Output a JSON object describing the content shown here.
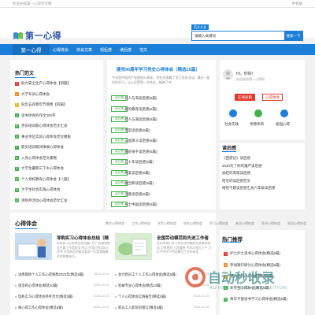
{
  "topbar": {
    "welcome": "欢迎光临第一心得范文网",
    "mobile": "手机版"
  },
  "logo": {
    "text": "第一心得"
  },
  "search": {
    "tag": "范文大全",
    "value": "请输入关键词",
    "button": "搜索一下"
  },
  "nav": {
    "brand": "第一心得",
    "items": [
      "心得体会",
      "体会文章",
      "观后感",
      "读后感",
      "范文"
    ]
  },
  "hot": {
    "title": "热门范文",
    "items": [
      {
        "num": "1",
        "text": "助力安全生产心得体会【四篇】",
        "color": "#e23a2e"
      },
      {
        "num": "2",
        "text": "大学军训心得体会",
        "color": "#f08c2e"
      },
      {
        "num": "3",
        "text": "纪念五四青年节感想【四篇】",
        "color": "#f0b52e"
      },
      {
        "num": "4",
        "text": "读书体会的作文300字",
        "color": "#42b14b"
      },
      {
        "num": "5",
        "text": "党员培训期心得体会范文汇总",
        "color": "#42b14b"
      },
      {
        "num": "6",
        "text": "事业单位实验心得体会范文模板",
        "color": "#42b14b"
      },
      {
        "num": "7",
        "text": "职员培训期间填收心得体会",
        "color": "#42b14b"
      },
      {
        "num": "8",
        "text": "入党心得体会范文集锦",
        "color": "#42b14b"
      },
      {
        "num": "9",
        "text": "大学生暑期三下乡心得体会",
        "color": "#42b14b"
      },
      {
        "num": "10",
        "text": "个人党校教育心得体会【八篇】",
        "color": "#42b14b"
      },
      {
        "num": "11",
        "text": "大学生社会实践心得体会",
        "color": "#42b14b"
      },
      {
        "num": "12",
        "text": "消防月活动心得体会范文汇总",
        "color": "#42b14b"
      }
    ]
  },
  "feature": {
    "title": "建党90周年学习党史心得体会（精选15篇）",
    "summary": "今年是中国共产党建党90周年。党在光荣履了学习党史活动。通过一段时间学习，让心灵受到一次洗礼，精神了许",
    "rows": [
      {
        "tag": "读后感",
        "title": "老人与海读后感(5篇)"
      },
      {
        "tag": "读后感",
        "title": "爱的教育读后感(5篇)"
      },
      {
        "tag": "读后感",
        "title": "老人与海读后感(5篇)"
      },
      {
        "tag": "读后感",
        "title": "无常读后感(5篇)"
      },
      {
        "tag": "读后感",
        "title": "三国演义读后感(5篇)"
      },
      {
        "tag": "读后感",
        "title": "骆驼祥子读后感(5篇)"
      },
      {
        "tag": "读后感",
        "title": "五十年读后感(5篇)"
      },
      {
        "tag": "读后感",
        "title": "简爱读后感(5篇)"
      },
      {
        "tag": "读后感",
        "title": "雅当和读后感(5篇)"
      },
      {
        "tag": "读后感",
        "title": "活着读后感(5篇)"
      },
      {
        "tag": "读后感",
        "title": "乡土中国读后感(5篇)"
      }
    ]
  },
  "user": {
    "greeting": "Hi，你好!",
    "sub": "欢迎来到第一心得网",
    "contribute": "在线投稿",
    "register": "心得体会",
    "icons": [
      {
        "label": "社会实践",
        "name": "briefcase-icon",
        "color": "#1c80d8"
      },
      {
        "label": "师德师风",
        "name": "book-icon",
        "color": "#42b14b"
      },
      {
        "label": "爱国心得",
        "name": "heart-icon",
        "color": "#1c80d8"
      }
    ]
  },
  "readafter": {
    "title": "读后感",
    "items": [
      "《西游记》读后感",
      "2020为了你的遵严读后感",
      "加娃的黑暗读后感",
      "哈尼的读后感范文",
      "哈哈千题读后感汇总六年级读后感"
    ]
  },
  "experience": {
    "title": "心得体会",
    "cats": [
      "教学心得体会",
      "工作心得体会",
      "学生心得体会",
      "综合心得体会",
      "学习心得体会",
      "安全心得体会",
      "军训心得体会",
      "党员心得体会"
    ],
    "articles": [
      {
        "title": "导购实习心得体会总结（精",
        "summary": "导购实习心得体会总结篇1 在广店最销售这主要工作是职务 所以 在我们的实际工作中 对导购员的基本要求一定要掌握基本的销售技巧…"
      },
      {
        "title": "全国劳动模范和先进工作者",
        "summary": "是如果我们学习的先进劳模的先进事迹材料 记得提到 工匠精神 今年20多位上午 习近平的关于劳动模范工作的讲话…"
      }
    ],
    "list": [
      {
        "text": "试用期转个人工作心得感想2023年(精选5篇)",
        "date": "2024-10-15"
      },
      {
        "text": "会计新员工个人工作心得体会(精选5篇)",
        "date": "2024-10-15"
      },
      {
        "text": "说话的心得体会(精选10篇)",
        "date": "2024-10-15"
      },
      {
        "text": "机械专业心得体会(精选10篇)",
        "date": "2024-10-15"
      },
      {
        "text": "电机实习心得体会参考范文(精选5篇)",
        "date": "2024-10-15"
      },
      {
        "text": "个人心得体会实践报告(精选5篇)",
        "date": "2024-10-15"
      },
      {
        "text": "两心得工作心得体会(精选5篇)",
        "date": "2024-10-15"
      },
      {
        "text": "新员工入职培训感言(精选5篇)",
        "date": "2024-10-15"
      }
    ]
  },
  "recommend": {
    "title": "热门推荐",
    "items": [
      {
        "num": "1",
        "text": "护士护士读书心得体会(精选5篇)",
        "color": "#e23a2e"
      },
      {
        "num": "2",
        "text": "参加银行研讨心得体会(精选5篇)",
        "color": "#f08c2e"
      },
      {
        "num": "3",
        "text": "党员学习心得体会(精选5篇)",
        "color": "#f0b52e"
      },
      {
        "num": "4",
        "text": "大学生心得体会(精选5篇)",
        "color": "#42b14b"
      },
      {
        "num": "5",
        "text": "青年干部读书学习心得体会(精选5篇)",
        "color": "#42b14b"
      }
    ]
  },
  "watermark": {
    "main": "自动秒收录",
    "sub": "AUTO SECOND COLLECTION"
  }
}
